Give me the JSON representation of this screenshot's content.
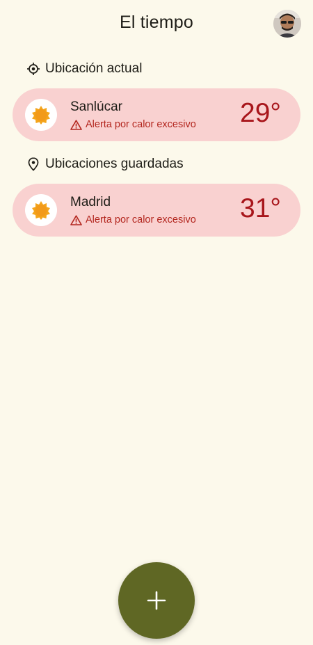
{
  "app": {
    "title": "El tiempo"
  },
  "current_location": {
    "header": "Ubicación actual",
    "icon": "location-target-icon",
    "card": {
      "city": "Sanlúcar",
      "alert": "Alerta por calor excesivo",
      "temperature": "29°",
      "weather_icon": "sun-icon"
    }
  },
  "saved_locations": {
    "header": "Ubicaciones guardadas",
    "icon": "map-pin-icon",
    "items": [
      {
        "city": "Madrid",
        "alert": "Alerta por calor excesivo",
        "temperature": "31°",
        "weather_icon": "sun-icon"
      }
    ]
  },
  "fab": {
    "icon": "plus-icon"
  },
  "colors": {
    "background": "#fcf9eb",
    "card": "#f9d1d0",
    "alert": "#b3261e",
    "temperature": "#a8161b",
    "fab": "#5f6724",
    "sun": "#f4a51c"
  }
}
